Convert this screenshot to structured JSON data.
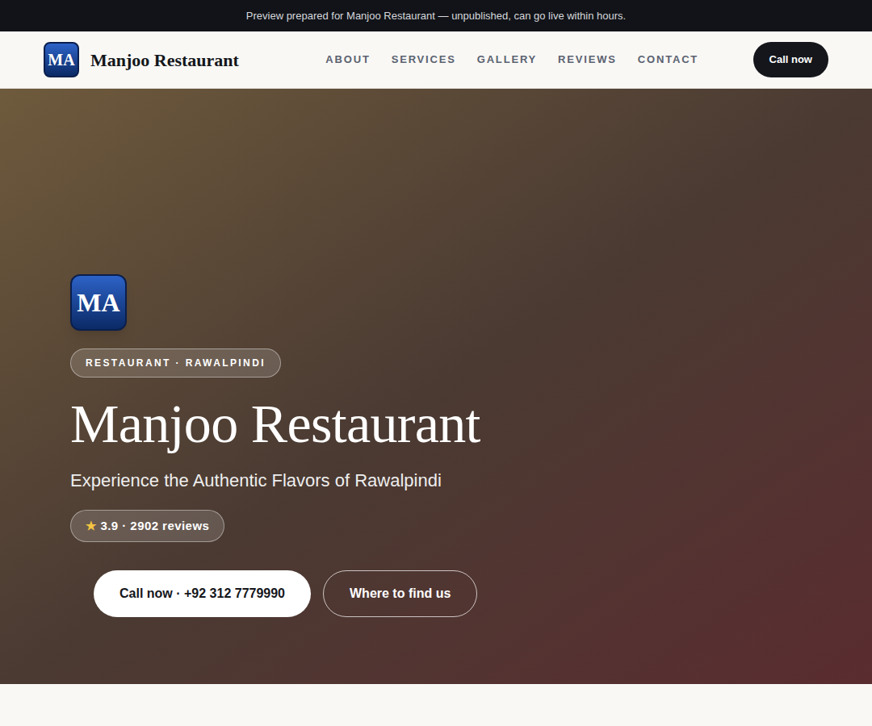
{
  "banner": {
    "text": "Preview prepared for Manjoo Restaurant — unpublished, can go live within hours."
  },
  "header": {
    "logo": "MA",
    "name": "Manjoo Restaurant",
    "nav": [
      {
        "label": "ABOUT"
      },
      {
        "label": "SERVICES"
      },
      {
        "label": "GALLERY"
      },
      {
        "label": "REVIEWS"
      },
      {
        "label": "CONTACT"
      }
    ],
    "button": "Call now"
  },
  "hero": {
    "logo": "MA",
    "badge": "RESTAURANT · RAWALPINDI",
    "title": "Manjoo Restaurant",
    "subtitle": "Experience the Authentic Flavors of Rawalpindi",
    "rating": {
      "star": "★",
      "text": "3.9 · 2902 reviews"
    },
    "buttons": [
      {
        "label": "Call now · +92 312 7779990",
        "kind": "primary"
      },
      {
        "label": "Where to find us",
        "kind": "outline"
      }
    ]
  }
}
